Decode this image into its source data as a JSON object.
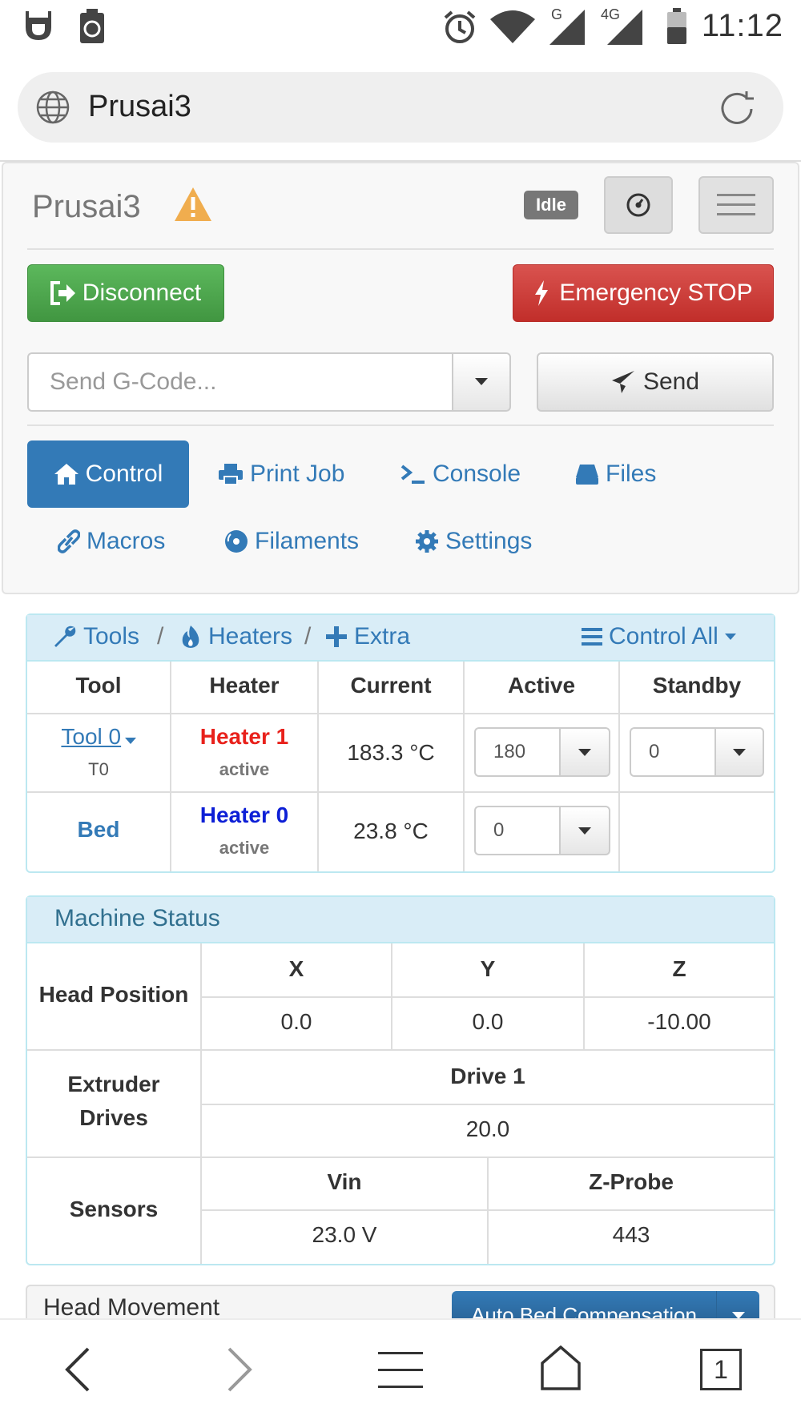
{
  "status_bar": {
    "time": "11:12",
    "signal1_label": "G",
    "signal2_label": "4G"
  },
  "browser": {
    "url": "Prusai3",
    "tab_count": "1"
  },
  "navbar": {
    "brand": "Prusai3",
    "status_badge": "Idle",
    "disconnect_label": "Disconnect",
    "estop_label": "Emergency STOP",
    "gcode_placeholder": "Send G-Code...",
    "send_label": "Send",
    "tabs": [
      {
        "label": "Control",
        "icon": "home-icon",
        "active": true
      },
      {
        "label": "Print Job",
        "icon": "printer-icon"
      },
      {
        "label": "Console",
        "icon": "console-icon"
      },
      {
        "label": "Files",
        "icon": "hdd-icon"
      },
      {
        "label": "Macros",
        "icon": "link-icon"
      },
      {
        "label": "Filaments",
        "icon": "cd-icon"
      },
      {
        "label": "Settings",
        "icon": "gear-icon"
      }
    ]
  },
  "tools": {
    "crumbs": [
      "Tools",
      "Heaters",
      "Extra"
    ],
    "separator": "/",
    "control_all": "Control All",
    "headers": [
      "Tool",
      "Heater",
      "Current",
      "Active",
      "Standby"
    ],
    "rows": [
      {
        "tool": "Tool 0",
        "tool_sub": "T0",
        "heater": "Heater 1",
        "heater_state": "active",
        "current": "183.3 °C",
        "active": "180",
        "standby": "0",
        "heater_color": "#e8211b"
      },
      {
        "tool": "Bed",
        "tool_sub": "",
        "heater": "Heater 0",
        "heater_state": "active",
        "current": "23.8 °C",
        "active": "0",
        "standby": "",
        "heater_color": "#0d1fd6"
      }
    ]
  },
  "machine_status": {
    "title": "Machine Status",
    "head_position_label": "Head Position",
    "axes": [
      "X",
      "Y",
      "Z"
    ],
    "positions": [
      "0.0",
      "0.0",
      "-10.00"
    ],
    "extruder_label_1": "Extruder",
    "extruder_label_2": "Drives",
    "drive_header": "Drive 1",
    "drive_value": "20.0",
    "sensors_label": "Sensors",
    "sensor_headers": [
      "Vin",
      "Z-Probe"
    ],
    "sensor_values": [
      "23.0 V",
      "443"
    ]
  },
  "head_movement": {
    "title": "Head Movement",
    "auto_bed_label": "Auto Bed Compensation"
  }
}
